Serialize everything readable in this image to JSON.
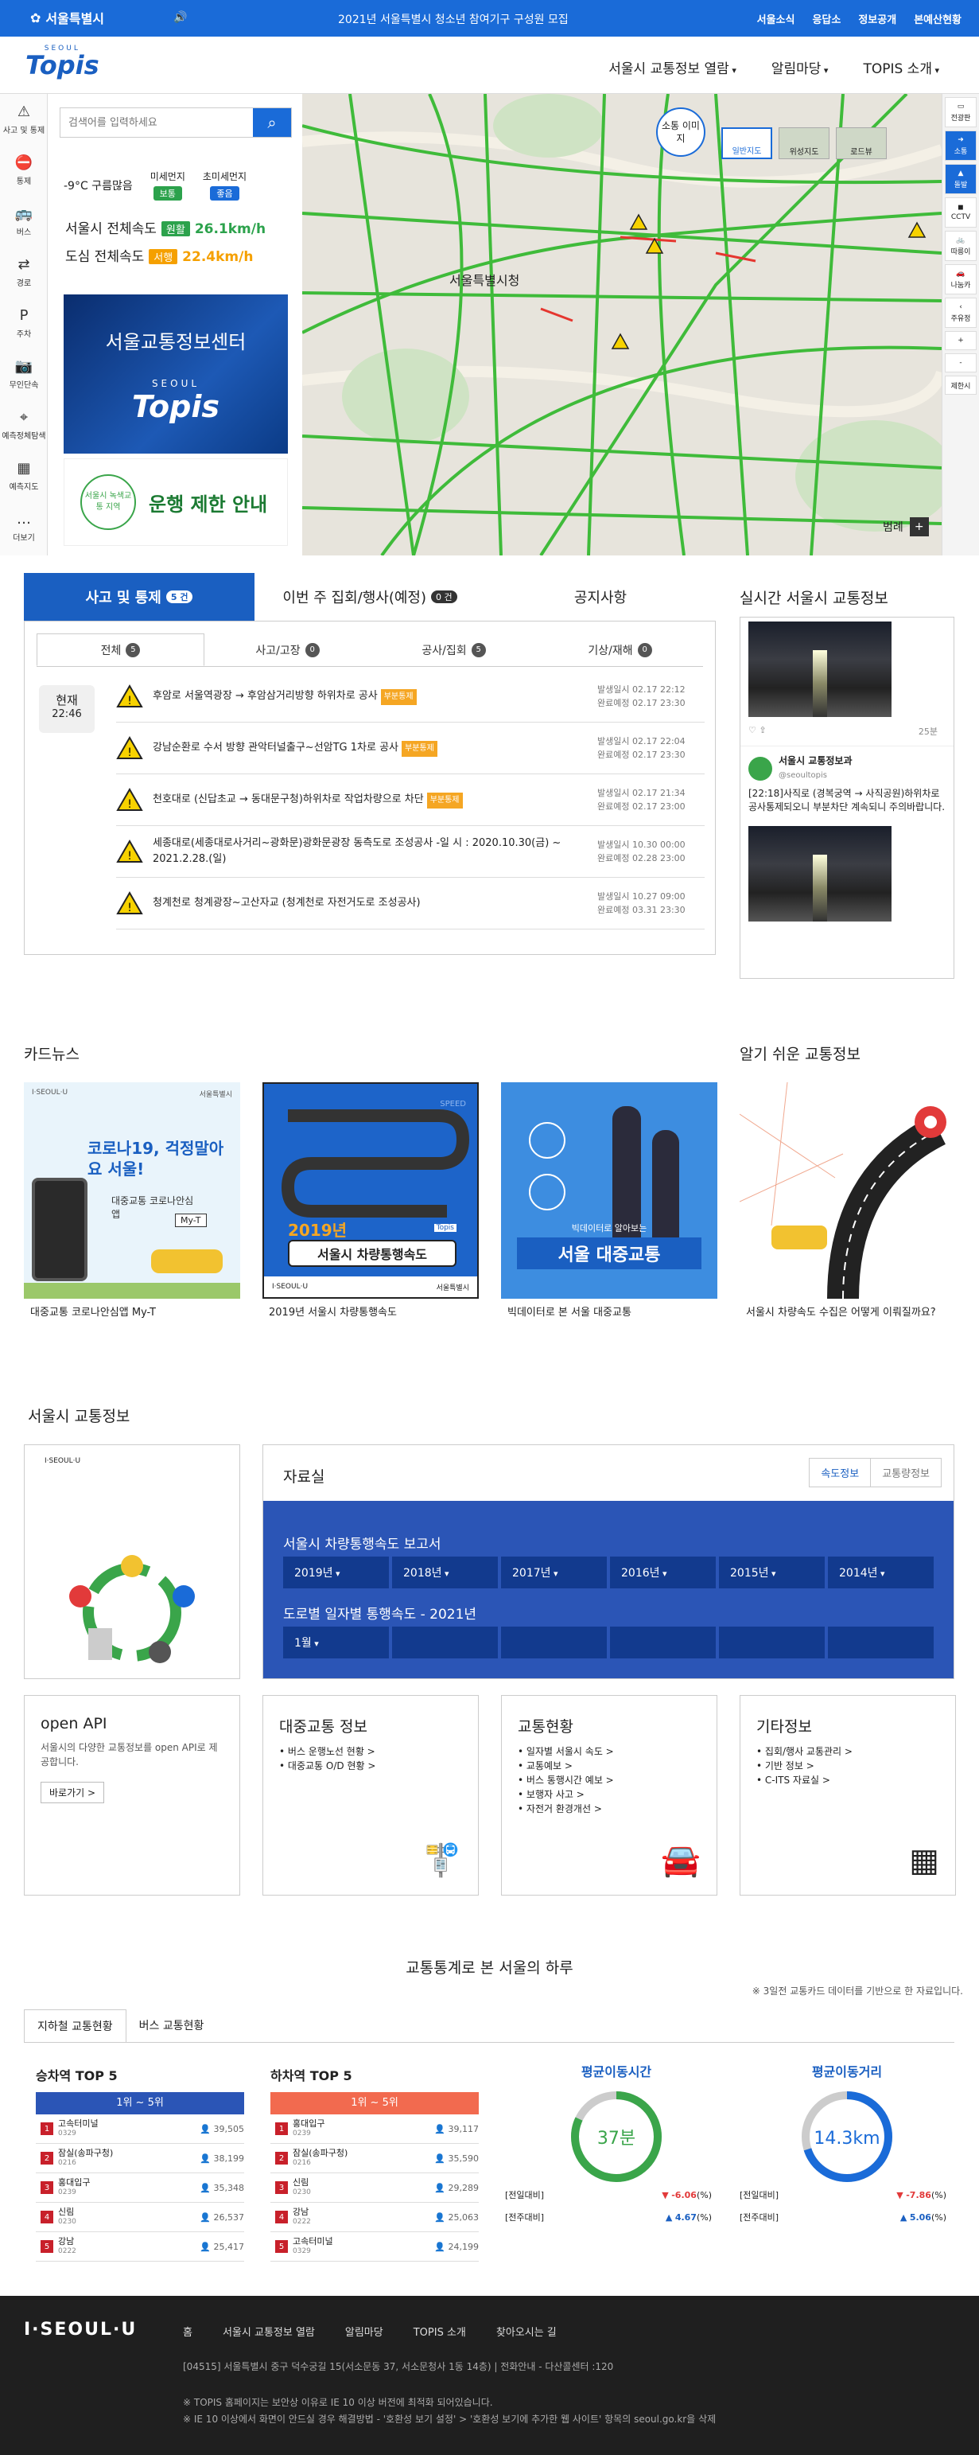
{
  "topbar": {
    "logo": "서울특별시",
    "notice": "2021년 서울특별시 청소년 참여기구 구성원 모집",
    "links": [
      "서울소식",
      "응답소",
      "정보공개",
      "본예산현황"
    ]
  },
  "header": {
    "brand_small": "SEOUL",
    "brand": "Topis",
    "nav": [
      "서울시 교통정보 열람",
      "알림마당",
      "TOPIS 소개"
    ]
  },
  "left_tools": [
    {
      "label": "사고 및 통제",
      "icon": "warning-icon"
    },
    {
      "label": "통제",
      "icon": "no-entry-icon"
    },
    {
      "label": "버스",
      "icon": "bus-icon"
    },
    {
      "label": "경로",
      "icon": "route-icon"
    },
    {
      "label": "주차",
      "icon": "parking-icon"
    },
    {
      "label": "무인단속",
      "icon": "camera-icon"
    },
    {
      "label": "예측정체탐색",
      "icon": "locate-icon"
    },
    {
      "label": "예측지도",
      "icon": "grid-icon"
    },
    {
      "label": "더보기",
      "icon": "more-icon"
    }
  ],
  "search": {
    "placeholder": "검색어를 입력하세요"
  },
  "weather": {
    "text": "-9°C 구름많음",
    "pm10_label": "미세먼지",
    "pm10": "보통",
    "pm25_label": "초미세먼지",
    "pm25": "좋음"
  },
  "speed": {
    "city_label": "서울시 전체속도",
    "city_status": "원활",
    "city_value": "26.1km/h",
    "downtown_label": "도심 전체속도",
    "downtown_status": "서행",
    "downtown_value": "22.4km/h"
  },
  "banners": {
    "center": "서울교통정보센터",
    "center_small": "SEOUL",
    "center_brand": "Topis",
    "green_circle": "서울시 녹색교통 지역",
    "green_text": "운행 제한 안내"
  },
  "map": {
    "sotong": "소통 이미지",
    "types": [
      "일반지도",
      "위성지도",
      "로드뷰"
    ],
    "label_cityhall": "서울특별시청",
    "legend": "범례",
    "right_tools": [
      "전광판",
      "소통",
      "돌발",
      "CCTV",
      "따릉이",
      "나눔카",
      "주유정",
      "+",
      "-",
      "제한시"
    ]
  },
  "accident": {
    "tabs": [
      {
        "label": "사고 및 통제",
        "count": "5 건"
      },
      {
        "label": "이번 주 집회/행사(예정)",
        "count": "0 건"
      },
      {
        "label": "공지사항",
        "count": ""
      }
    ],
    "subtabs": [
      {
        "label": "전체",
        "count": "5"
      },
      {
        "label": "사고/고장",
        "count": "0"
      },
      {
        "label": "공사/집회",
        "count": "5"
      },
      {
        "label": "기상/재해",
        "count": "0"
      }
    ],
    "now_label": "현재",
    "now_time": "22:46",
    "items": [
      {
        "text": "후암로 서울역광장 → 후암삼거리방향 하위차로 공사",
        "tag": "부분통제",
        "start": "발생일시 02.17 22:12",
        "end": "완료예정 02.17 23:30"
      },
      {
        "text": "강남순환로 수서 방향 관악터널출구~선암TG 1차로 공사",
        "tag": "부분통제",
        "start": "발생일시 02.17 22:04",
        "end": "완료예정 02.17 23:30"
      },
      {
        "text": "천호대로 (신답초교 → 동대문구청)하위차로 작업차량으로 차단",
        "tag": "부분통제",
        "start": "발생일시 02.17 21:34",
        "end": "완료예정 02.17 23:00"
      },
      {
        "text": "세종대로(세종대로사거리~광화문)광화문광장 동측도로 조성공사 -일 시 : 2020.10.30(금) ~ 2021.2.28.(일)",
        "tag": "",
        "start": "발생일시 10.30 00:00",
        "end": "완료예정 02.28 23:00"
      },
      {
        "text": "청계천로 청계광장~고산자교 (청계천로 자전거도로 조성공사)",
        "tag": "",
        "start": "발생일시 10.27 09:00",
        "end": "완료예정 03.31 23:30"
      }
    ]
  },
  "realtime": {
    "title": "실시간 서울시 교통정보",
    "minutes": "25분",
    "account": "서울시 교통정보과",
    "handle": "@seoultopis",
    "tweet": "[22:18]사직로 (경복궁역 → 사직공원)하위차로 공사통제되오니 부분차단 계속되니 주의바랍니다."
  },
  "cardnews": {
    "title": "카드뉴스",
    "items": [
      {
        "caption": "대중교통 코로나안심앱 My-T",
        "img_title": "코로나19, 걱정말아요 서울!",
        "img_sub": "대중교통 코로나안심앱",
        "img_tag": "My-T",
        "brand": "I·SEOUL·U",
        "brand2": "서울특별시"
      },
      {
        "caption": "2019년 서울시 차량통행속도",
        "img_year": "2019년",
        "img_title": "서울시 차량통행속도",
        "img_speed": "SPEED",
        "brand": "I·SEOUL·U",
        "brand2": "서울특별시",
        "topis": "Topis"
      },
      {
        "caption": "빅데이터로 본 서울 대중교통",
        "img_sub": "빅데이터로 알아보는",
        "img_title": "서울 대중교통"
      }
    ],
    "easy_title": "알기 쉬운 교통정보",
    "easy_caption": "서울시 차량속도 수집은 어떻게 이뤄질까요?"
  },
  "traffic_info": {
    "title": "서울시 교통정보",
    "brand": "I·SEOUL·U",
    "jaryo_title": "자료실",
    "jtabs": [
      "속도정보",
      "교통량정보"
    ],
    "report1": "서울시 차량통행속도 보고서",
    "years": [
      "2019년",
      "2018년",
      "2017년",
      "2016년",
      "2015년",
      "2014년"
    ],
    "report2": "도로별 일자별 통행속도 - 2021년",
    "month": "1월",
    "cards": [
      {
        "title": "open API",
        "desc": "서울시의 다양한 교통정보를 open API로 제공합니다.",
        "btn": "바로가기 >"
      },
      {
        "title": "대중교통 정보",
        "items": [
          "버스 운행노선 현황 >",
          "대중교통 O/D 현황 >"
        ]
      },
      {
        "title": "교통현황",
        "items": [
          "일자별 서울시 속도 >",
          "교통예보 >",
          "버스 통행시간 예보 >",
          "보행자 사고 >",
          "자전거 환경개선 >"
        ]
      },
      {
        "title": "기타정보",
        "items": [
          "집회/행사 교통관리 >",
          "기반 정보 >",
          "C-ITS 자료실 >"
        ]
      }
    ]
  },
  "stats": {
    "title": "교통통계로 본 서울의 하루",
    "note": "※ 3일전 교통카드 데이터를 기반으로 한 자료입니다.",
    "tabs": [
      "지하철 교통현황",
      "버스 교통현황"
    ],
    "board": {
      "title": "승차역 TOP 5",
      "range": "1위 ~ 5위",
      "rows": [
        {
          "rank": "1",
          "name": "고속터미널",
          "code": "0329",
          "value": "39,505"
        },
        {
          "rank": "2",
          "name": "잠실(송파구청)",
          "code": "0216",
          "value": "38,199"
        },
        {
          "rank": "3",
          "name": "홍대입구",
          "code": "0239",
          "value": "35,348"
        },
        {
          "rank": "4",
          "name": "신림",
          "code": "0230",
          "value": "26,537"
        },
        {
          "rank": "5",
          "name": "강남",
          "code": "0222",
          "value": "25,417"
        }
      ]
    },
    "alight": {
      "title": "하차역 TOP 5",
      "range": "1위 ~ 5위",
      "rows": [
        {
          "rank": "1",
          "name": "홍대입구",
          "code": "0239",
          "value": "39,117"
        },
        {
          "rank": "2",
          "name": "잠실(송파구청)",
          "code": "0216",
          "value": "35,590"
        },
        {
          "rank": "3",
          "name": "신림",
          "code": "0230",
          "value": "29,289"
        },
        {
          "rank": "4",
          "name": "강남",
          "code": "0222",
          "value": "25,063"
        },
        {
          "rank": "5",
          "name": "고속터미널",
          "code": "0329",
          "value": "24,199"
        }
      ]
    },
    "avg_time": {
      "title": "평균이동시간",
      "value": "37분",
      "prev_day": "[전일대비]",
      "prev_day_v": "-6.06",
      "prev_week": "[전주대비]",
      "prev_week_v": "4.67",
      "unit": "(%)",
      "fill": 0.82
    },
    "avg_dist": {
      "title": "평균이동거리",
      "value": "14.3km",
      "prev_day": "[전일대비]",
      "prev_day_v": "-7.86",
      "prev_week": "[전주대비]",
      "prev_week_v": "5.06",
      "unit": "(%)",
      "fill": 0.7
    }
  },
  "footer": {
    "logo": "I·SEOUL·U",
    "nav": [
      "홈",
      "서울시 교통정보 열람",
      "알림마당",
      "TOPIS 소개",
      "찾아오시는 길"
    ],
    "addr": "[04515] 서울특별시 중구 덕수궁길 15(서소문동 37, 서소문청사 1동 14층)  |  전화안내 - 다산콜센터 :120",
    "note1": "※ TOPIS 홈페이지는 보안상 이유로 IE 10 이상 버전에 최적화 되어있습니다.",
    "note2": "※ IE 10 이상에서 화면이 안드실 경우 해결방법 - '호환성 보기 설정' > '호환성 보기에 추가한 웹 사이트' 항목의 seoul.go.kr을 삭제"
  },
  "colors": {
    "primary": "#1a6bd8",
    "navy": "#1a5fc1",
    "orange": "#f5a623",
    "green": "#3aa54a",
    "red_header": "#f26a4f"
  }
}
